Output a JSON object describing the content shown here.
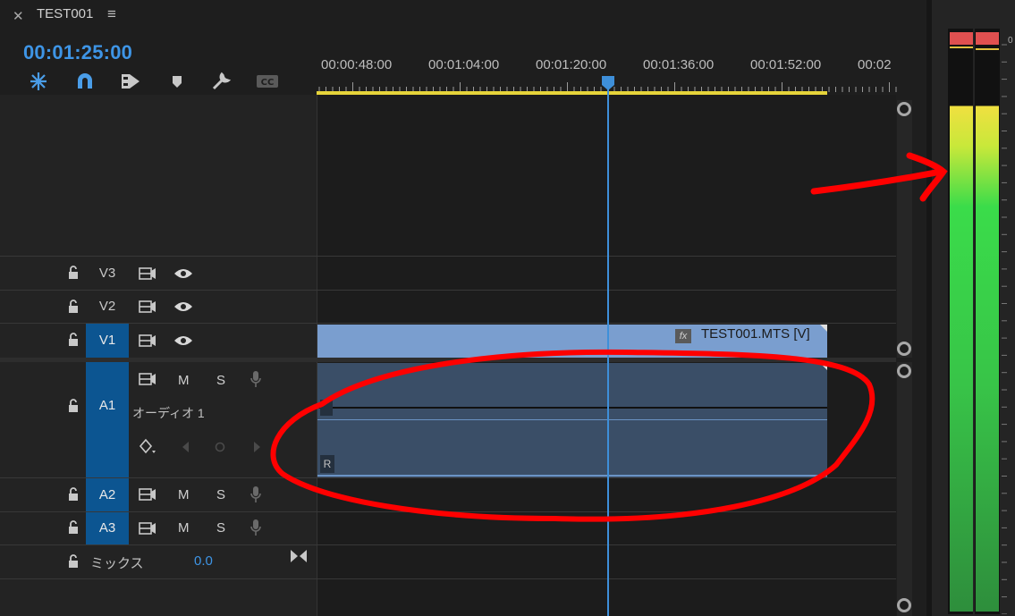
{
  "panel": {
    "title": "TEST001",
    "close_icon": "close-icon",
    "menu_icon": "hamburger-menu-icon"
  },
  "timecode": "00:01:25:00",
  "toolbar": {
    "tools": [
      "insert-sequence-nest-icon",
      "snap-magnet-icon",
      "linked-selection-icon",
      "add-marker-icon",
      "wrench-settings-icon",
      "captions-cc-icon"
    ]
  },
  "ruler": {
    "labels": [
      "00:00:48:00",
      "00:01:04:00",
      "00:01:20:00",
      "00:01:36:00",
      "00:01:52:00",
      "00:02"
    ],
    "playhead": "00:01:25:00"
  },
  "tracks": {
    "v3": {
      "name": "V3"
    },
    "v2": {
      "name": "V2"
    },
    "v1": {
      "name": "V1"
    },
    "a1": {
      "name": "A1",
      "label": "オーディオ 1",
      "mute": "M",
      "solo": "S"
    },
    "a2": {
      "name": "A2",
      "mute": "M",
      "solo": "S"
    },
    "a3": {
      "name": "A3",
      "mute": "M",
      "solo": "S"
    },
    "mix": {
      "name": "ミックス",
      "value": "0.0"
    }
  },
  "clips": {
    "video": {
      "name": "TEST001.MTS [V]",
      "fx": "fx"
    },
    "audio": {
      "channel_r": "R"
    }
  },
  "meter": {
    "top_label": "0",
    "level": 0.87
  },
  "colors": {
    "accent": "#3e95e6",
    "active_track": "#0c5591",
    "video_clip": "#7a9ecf",
    "audio_clip": "#3a4e67",
    "annotation": "#ff0000",
    "work_area": "#e6d43a"
  }
}
